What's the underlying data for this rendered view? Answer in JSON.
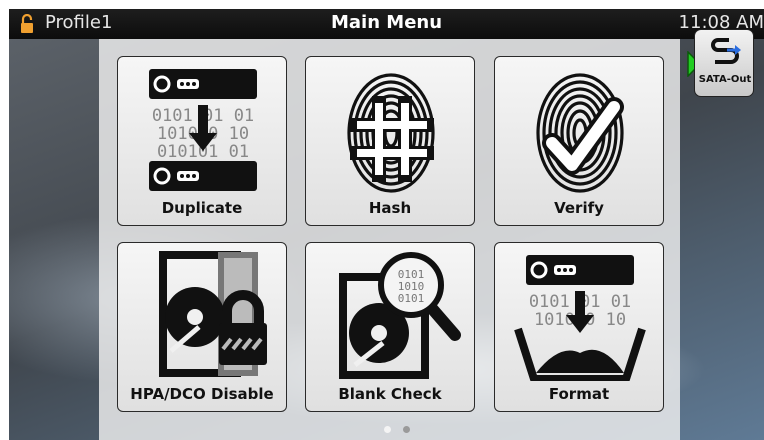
{
  "statusbar": {
    "profile": "Profile1",
    "title": "Main Menu",
    "time": "11:08 AM",
    "lock_color": "#f0a030"
  },
  "menu": {
    "tiles": [
      {
        "label": "Duplicate",
        "icon": "duplicate-icon"
      },
      {
        "label": "Hash",
        "icon": "fingerprint-hash-icon"
      },
      {
        "label": "Verify",
        "icon": "fingerprint-check-icon"
      },
      {
        "label": "HPA/DCO Disable",
        "icon": "drive-lock-icon"
      },
      {
        "label": "Blank Check",
        "icon": "drive-magnifier-icon"
      },
      {
        "label": "Format",
        "icon": "format-icon"
      }
    ],
    "binary_text": {
      "row1": "0101 01 01",
      "row2": "1010 0 10",
      "row3": "010101 01"
    }
  },
  "pager": {
    "pages": 2,
    "current": 1
  },
  "side_panel": {
    "sata_out_label": "SATA-Out",
    "arrow_color": "#22cc22"
  }
}
